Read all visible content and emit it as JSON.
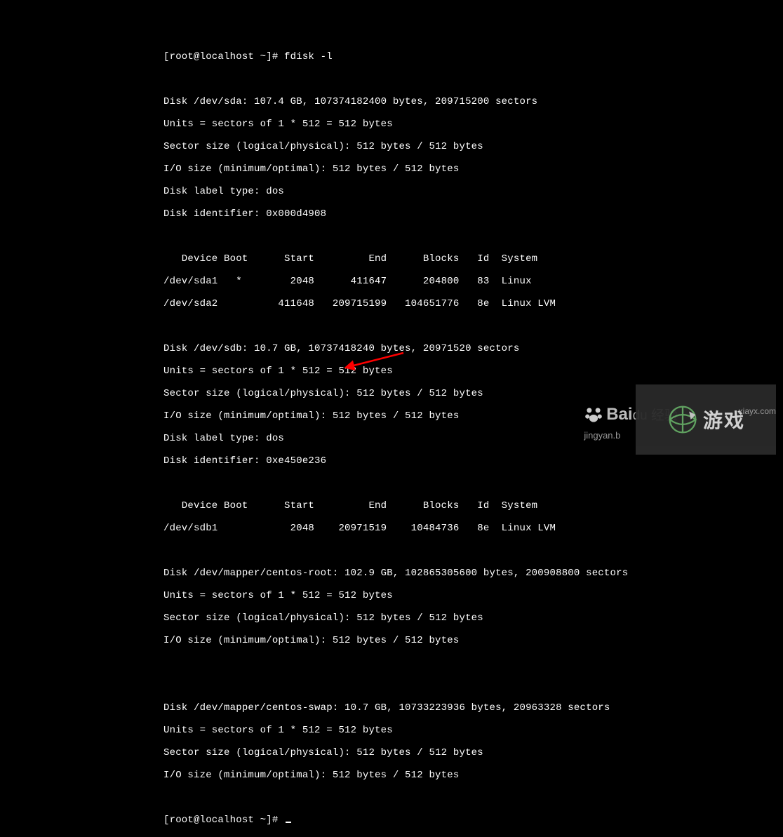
{
  "terminal": {
    "prompt1": "[root@localhost ~]# fdisk -l",
    "blank": "",
    "sda": {
      "header": "Disk /dev/sda: 107.4 GB, 107374182400 bytes, 209715200 sectors",
      "units": "Units = sectors of 1 * 512 = 512 bytes",
      "sector": "Sector size (logical/physical): 512 bytes / 512 bytes",
      "io": "I/O size (minimum/optimal): 512 bytes / 512 bytes",
      "label": "Disk label type: dos",
      "ident": "Disk identifier: 0x000d4908",
      "th": "   Device Boot      Start         End      Blocks   Id  System",
      "p1": "/dev/sda1   *        2048      411647      204800   83  Linux",
      "p2": "/dev/sda2          411648   209715199   104651776   8e  Linux LVM"
    },
    "sdb": {
      "header": "Disk /dev/sdb: 10.7 GB, 10737418240 bytes, 20971520 sectors",
      "units": "Units = sectors of 1 * 512 = 512 bytes",
      "sector": "Sector size (logical/physical): 512 bytes / 512 bytes",
      "io": "I/O size (minimum/optimal): 512 bytes / 512 bytes",
      "label": "Disk label type: dos",
      "ident": "Disk identifier: 0xe450e236",
      "th": "   Device Boot      Start         End      Blocks   Id  System",
      "p1": "/dev/sdb1            2048    20971519    10484736   8e  Linux LVM"
    },
    "root": {
      "header": "Disk /dev/mapper/centos-root: 102.9 GB, 102865305600 bytes, 200908800 sectors",
      "units": "Units = sectors of 1 * 512 = 512 bytes",
      "sector": "Sector size (logical/physical): 512 bytes / 512 bytes",
      "io": "I/O size (minimum/optimal): 512 bytes / 512 bytes"
    },
    "swap": {
      "header": "Disk /dev/mapper/centos-swap: 10.7 GB, 10733223936 bytes, 20963328 sectors",
      "units": "Units = sectors of 1 * 512 = 512 bytes",
      "sector": "Sector size (logical/physical): 512 bytes / 512 bytes",
      "io": "I/O size (minimum/optimal): 512 bytes / 512 bytes"
    },
    "prompt2": "[root@localhost ~]# "
  },
  "annotation": {
    "arrow_color": "#ff0000"
  },
  "watermarks": {
    "baidu_main": "Bai",
    "baidu_suffix": "du 经验",
    "baidu_sub": "jingyan.b",
    "xiayx": "xiayx.com",
    "game_text": "游戏"
  }
}
